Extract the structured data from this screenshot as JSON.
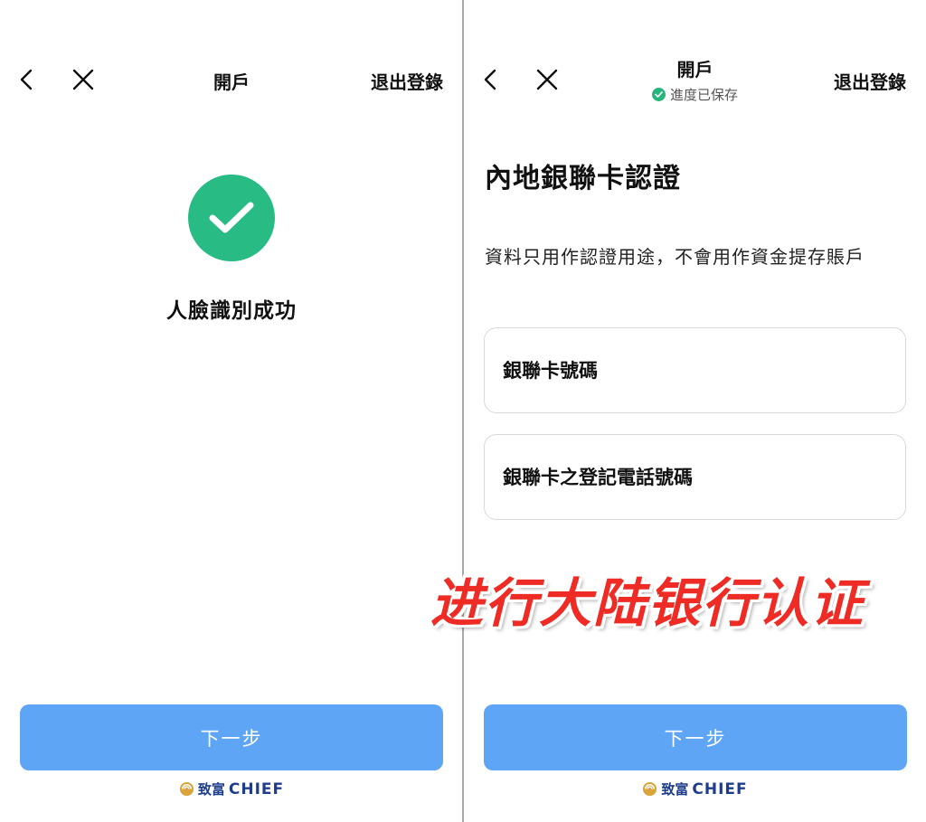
{
  "left_panel": {
    "nav": {
      "title": "開戶",
      "logout_label": "退出登錄"
    },
    "success_message": "人臉識別成功",
    "next_button": "下一步",
    "brand": {
      "cn": "致富",
      "en": "CHIEF"
    }
  },
  "right_panel": {
    "nav": {
      "title": "開戶",
      "saved_status": "進度已保存",
      "logout_label": "退出登錄"
    },
    "section_title": "內地銀聯卡認證",
    "description": "資料只用作認證用途，不會用作資金提存賬戶",
    "fields": {
      "card_number_placeholder": "銀聯卡號碼",
      "phone_placeholder": "銀聯卡之登記電話號碼"
    },
    "next_button": "下一步",
    "brand": {
      "cn": "致富",
      "en": "CHIEF"
    }
  },
  "overlay_caption": "进行大陆银行认证",
  "colors": {
    "success_green": "#28bb84",
    "button_blue": "#5fa5f5",
    "brand_navy": "#1f3d8c",
    "overlay_red": "#ee2b24"
  },
  "icons": [
    "back-icon",
    "close-icon",
    "check-icon",
    "saved-check-icon",
    "brand-logo-icon"
  ]
}
